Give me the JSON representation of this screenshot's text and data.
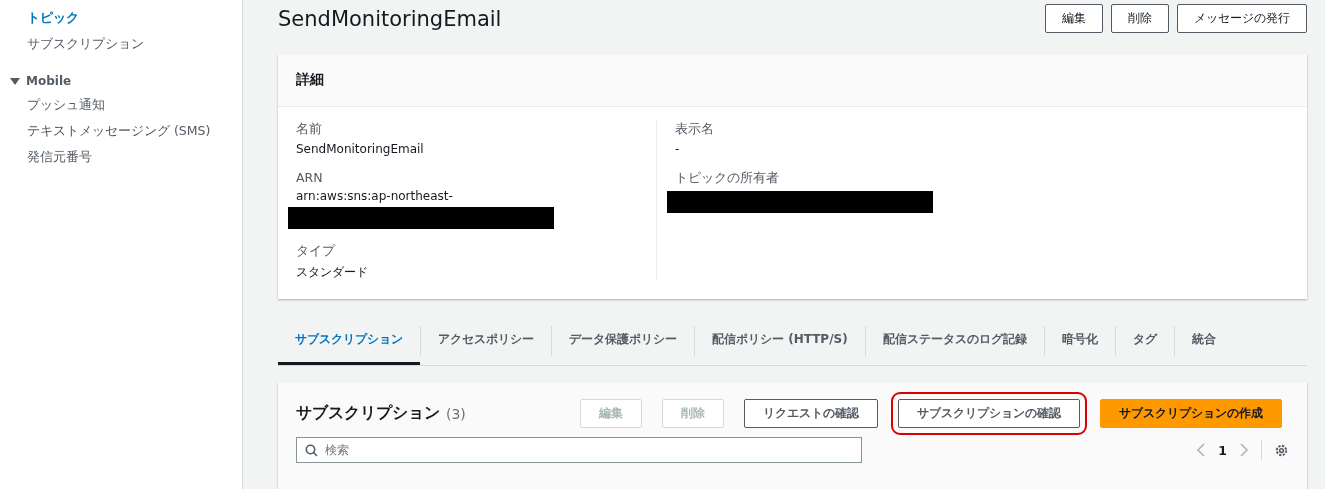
{
  "sidebar": {
    "items": [
      {
        "label": "トピック",
        "selected": true
      },
      {
        "label": "サブスクリプション",
        "selected": false
      }
    ],
    "sections": [
      {
        "title": "Mobile",
        "expanded": true,
        "items": [
          {
            "label": "プッシュ通知",
            "selected": false
          },
          {
            "label": "テキストメッセージング (SMS)",
            "selected": false
          },
          {
            "label": "発信元番号",
            "selected": false
          }
        ]
      }
    ]
  },
  "page": {
    "title": "SendMonitoringEmail",
    "actions": [
      {
        "label": "編集",
        "disabled": false
      },
      {
        "label": "削除",
        "disabled": false
      },
      {
        "label": "メッセージの発行",
        "disabled": false
      }
    ]
  },
  "details": {
    "title": "詳細",
    "columns": [
      [
        {
          "label": "名前",
          "value": "SendMonitoringEmail"
        },
        {
          "label": "ARN",
          "value": "arn:aws:sns:ap-northeast-",
          "redacted": true
        },
        {
          "label": "タイプ",
          "value": "スタンダード"
        }
      ],
      [
        {
          "label": "表示名",
          "value": "-"
        },
        {
          "label": "トピックの所有者",
          "redacted": true
        }
      ]
    ]
  },
  "tabs": [
    {
      "label": "サブスクリプション",
      "selected": true
    },
    {
      "label": "アクセスポリシー",
      "selected": false
    },
    {
      "label": "データ保護ポリシー",
      "selected": false
    },
    {
      "label": "配信ポリシー (HTTP/S)",
      "selected": false
    },
    {
      "label": "配信ステータスのログ記録",
      "selected": false
    },
    {
      "label": "暗号化",
      "selected": false
    },
    {
      "label": "タグ",
      "selected": false
    },
    {
      "label": "統合",
      "selected": false
    }
  ],
  "subscriptions": {
    "title": "サブスクリプション",
    "count": "(3)",
    "actions": [
      {
        "label": "編集",
        "kind": "normal",
        "disabled": true,
        "highlighted": false
      },
      {
        "label": "削除",
        "kind": "normal",
        "disabled": true,
        "highlighted": false
      },
      {
        "label": "リクエストの確認",
        "kind": "normal",
        "disabled": false,
        "highlighted": false
      },
      {
        "label": "サブスクリプションの確認",
        "kind": "normal",
        "disabled": false,
        "highlighted": true
      },
      {
        "label": "サブスクリプションの作成",
        "kind": "primary",
        "disabled": false,
        "highlighted": false
      }
    ],
    "search": {
      "placeholder": "検索"
    },
    "page": "1"
  }
}
